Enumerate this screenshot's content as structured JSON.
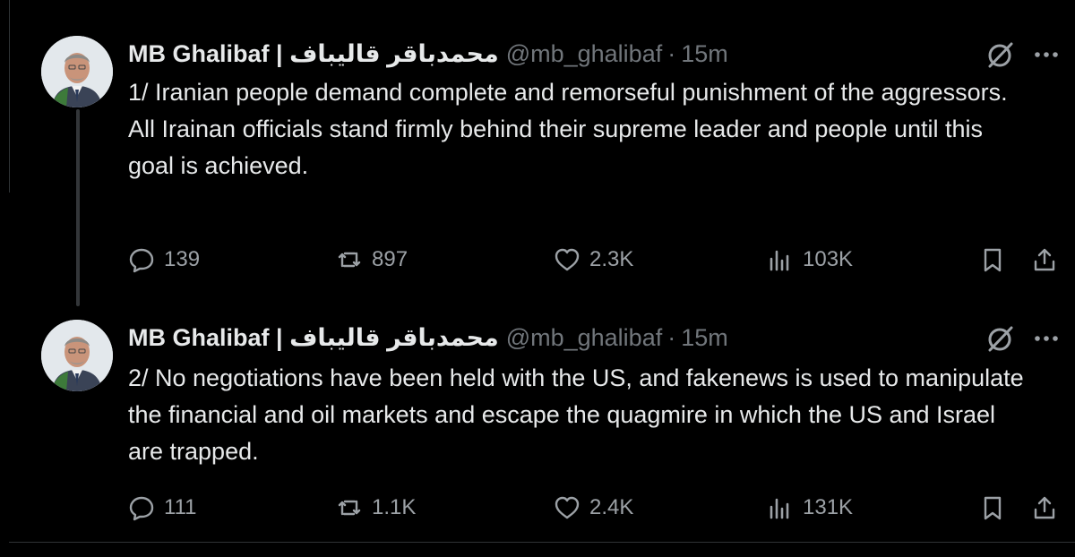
{
  "colors": {
    "background": "#000000",
    "primary_text": "#e7e9ea",
    "secondary_text": "#71767b",
    "icon_gray": "#9ca1a6",
    "divider": "#2f3336"
  },
  "tweets": [
    {
      "author_name": "محمدباقر قالیباف | MB Ghalibaf",
      "handle": "@mb_ghalibaf",
      "separator": "·",
      "time": "15m",
      "text_lines": [
        "1/ Iranian people demand complete and remorseful punishment of the aggressors.",
        "All Irainan officials stand firmly behind their supreme leader and people until this goal is achieved."
      ],
      "stats": {
        "replies": "139",
        "retweets": "897",
        "likes": "2.3K",
        "views": "103K"
      },
      "icons": [
        "grok-icon",
        "more-icon",
        "reply-icon",
        "retweet-icon",
        "like-icon",
        "views-icon",
        "bookmark-icon",
        "share-icon"
      ]
    },
    {
      "author_name": "محمدباقر قالیباف | MB Ghalibaf",
      "handle": "@mb_ghalibaf",
      "separator": "·",
      "time": "15m",
      "text_lines": [
        "2/ No negotiations have been held with the US, and fakenews is used to manipulate the financial and oil markets and escape the quagmire in which the US and Israel are trapped."
      ],
      "stats": {
        "replies": "111",
        "retweets": "1.1K",
        "likes": "2.4K",
        "views": "131K"
      },
      "icons": [
        "grok-icon",
        "more-icon",
        "reply-icon",
        "retweet-icon",
        "like-icon",
        "views-icon",
        "bookmark-icon",
        "share-icon"
      ]
    }
  ]
}
